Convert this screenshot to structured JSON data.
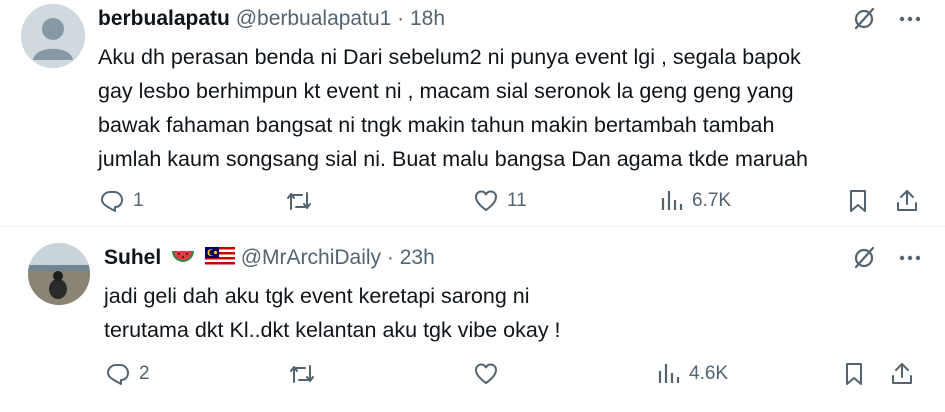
{
  "tweets": [
    {
      "name": "berbualapatu",
      "handle": "@berbualapatu1",
      "separator": "·",
      "time": "18h",
      "text_lines": [
        "Aku dh perasan benda ni Dari sebelum2 ni punya event lgi , segala bapok",
        "gay lesbo berhimpun kt event ni , macam sial seronok la geng geng yang",
        "bawak fahaman bangsat ni tngk makin tahun makin bertambah tambah",
        "jumlah kaum songsang sial ni. Buat malu bangsa Dan agama tkde maruah"
      ],
      "replies": "1",
      "retweets": "",
      "likes": "11",
      "views": "6.7K"
    },
    {
      "name": "Suhel",
      "handle": "@MrArchiDaily",
      "separator": "·",
      "time": "23h",
      "text_lines": [
        "jadi geli dah aku tgk event keretapi sarong ni",
        "terutama dkt Kl..dkt kelantan aku tgk vibe okay !"
      ],
      "replies": "2",
      "retweets": "",
      "likes": "",
      "views": "4.6K"
    }
  ],
  "icons": {
    "more": "more-icon",
    "grok": "grok-icon",
    "reply": "reply-icon",
    "retweet": "retweet-icon",
    "like": "like-icon",
    "views": "views-icon",
    "bookmark": "bookmark-icon",
    "share": "share-icon"
  },
  "colors": {
    "text": "#0f1419",
    "secondary": "#536471",
    "divider": "#eff3f4"
  }
}
